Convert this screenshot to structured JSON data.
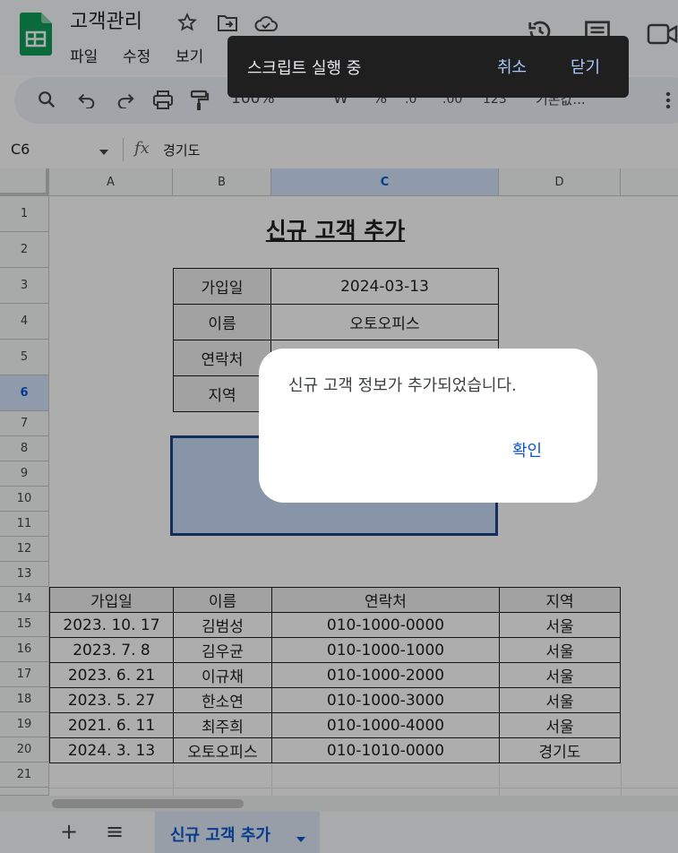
{
  "header": {
    "title": "고객관리",
    "menu": [
      "파일",
      "수정",
      "보기"
    ],
    "icons": [
      "sheets-logo-icon",
      "star-icon",
      "move-folder-icon",
      "cloud-status-icon",
      "history-icon",
      "comment-icon",
      "video-call-icon"
    ]
  },
  "toolbar": {
    "zoom": "100%",
    "currency": "₩",
    "percent": "%",
    "dec_decrease": ".0",
    "dec_increase": ".00",
    "number_format": "123",
    "font": "기본값...",
    "icons": [
      "search-icon",
      "undo-icon",
      "redo-icon",
      "print-icon",
      "paint-format-icon",
      "more-vert-icon"
    ]
  },
  "formula_bar": {
    "name_box": "C6",
    "fx": "fx",
    "value": "경기도"
  },
  "columns": [
    "A",
    "B",
    "C",
    "D"
  ],
  "rows": [
    "1",
    "2",
    "3",
    "4",
    "5",
    "6",
    "7",
    "8",
    "9",
    "10",
    "11",
    "12",
    "13",
    "14",
    "15",
    "16",
    "17",
    "18",
    "19",
    "20",
    "21"
  ],
  "form": {
    "title": "신규 고객 추가",
    "labels": [
      "가입일",
      "이름",
      "연락처",
      "지역"
    ],
    "values": [
      "2024-03-13",
      "오토오피스"
    ]
  },
  "table": {
    "headers": [
      "가입일",
      "이름",
      "연락처",
      "지역"
    ],
    "rows": [
      [
        "2023. 10. 17",
        "김범성",
        "010-1000-0000",
        "서울"
      ],
      [
        "2023. 7. 8",
        "김우균",
        "010-1000-1000",
        "서울"
      ],
      [
        "2023. 6. 21",
        "이규채",
        "010-1000-2000",
        "서울"
      ],
      [
        "2023. 5. 27",
        "한소연",
        "010-1000-3000",
        "서울"
      ],
      [
        "2021. 6. 11",
        "최주희",
        "010-1000-4000",
        "서울"
      ],
      [
        "2024. 3. 13",
        "오토오피스",
        "010-1010-0000",
        "경기도"
      ]
    ]
  },
  "sheet_tabs": {
    "add": "+",
    "all_sheets": "≡",
    "active": "신규 고객 추가"
  },
  "toast": {
    "message": "스크립트 실행 중",
    "cancel": "취소",
    "close": "닫기"
  },
  "dialog": {
    "message": "신규 고객 정보가 추가되었습니다.",
    "ok": "확인"
  }
}
